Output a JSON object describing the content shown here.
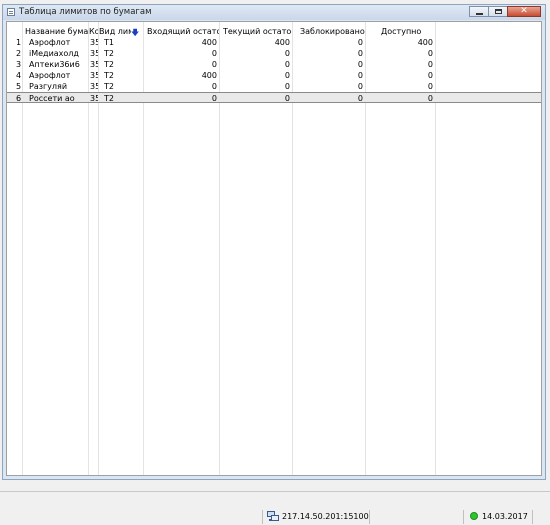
{
  "window": {
    "title": "Таблица лимитов по бумагам"
  },
  "table": {
    "headers": {
      "num": "",
      "name": "Название бумаги",
      "code": "Ко",
      "sep": "",
      "limit_type": "Вид лим",
      "incoming": "Входящий остаток",
      "current": "Текущий остаток",
      "blocked": "Заблокировано",
      "available": "Доступно"
    },
    "sort_indicator": "descending",
    "rows": [
      {
        "num": "1",
        "name": "Аэрофлот",
        "code": "35.",
        "limit_type": "T1",
        "incoming": "400",
        "current": "400",
        "blocked": "0",
        "available": "400"
      },
      {
        "num": "2",
        "name": "iМедиахолд",
        "code": "35.",
        "limit_type": "T2",
        "incoming": "0",
        "current": "0",
        "blocked": "0",
        "available": "0"
      },
      {
        "num": "3",
        "name": "Аптеки36и6",
        "code": "35.",
        "limit_type": "T2",
        "incoming": "0",
        "current": "0",
        "blocked": "0",
        "available": "0"
      },
      {
        "num": "4",
        "name": "Аэрофлот",
        "code": "35.",
        "limit_type": "T2",
        "incoming": "400",
        "current": "0",
        "blocked": "0",
        "available": "0"
      },
      {
        "num": "5",
        "name": "Разгуляй",
        "code": "35.",
        "limit_type": "T2",
        "incoming": "0",
        "current": "0",
        "blocked": "0",
        "available": "0"
      },
      {
        "num": "6",
        "name": "Россети ао",
        "code": "35.",
        "limit_type": "T2",
        "incoming": "0",
        "current": "0",
        "blocked": "0",
        "available": "0"
      }
    ],
    "selected_row": 6
  },
  "status": {
    "connection": "217.14.50.201:15100",
    "date": "14.03.2017",
    "connected_color": "#2dc42d"
  },
  "icons": {
    "window": "table-window-icon",
    "sort": "sort-descending-icon",
    "network": "network-connection-icon",
    "status": "connection-status-icon"
  }
}
